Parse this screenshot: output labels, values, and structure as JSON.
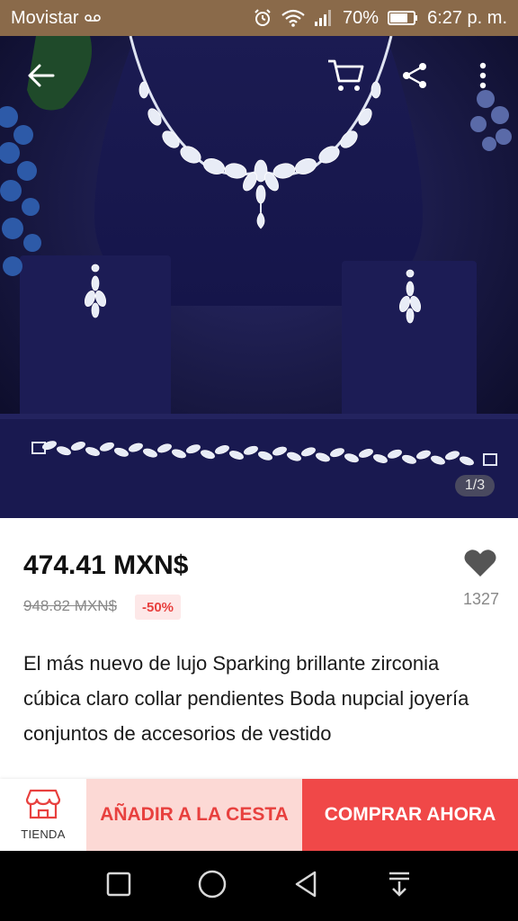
{
  "status_bar": {
    "carrier": "Movistar",
    "battery": "70%",
    "time": "6:27 p. m."
  },
  "icons": {
    "back": "arrow-left-icon",
    "cart": "shopping-cart-icon",
    "share": "share-icon",
    "more": "more-vertical-icon",
    "favorite": "heart-icon",
    "store": "store-icon"
  },
  "gallery": {
    "indicator": "1/3"
  },
  "product": {
    "price": "474.41 MXN$",
    "original_price": "948.82 MXN$",
    "discount": "-50%",
    "favorites_count": "1327",
    "title": "El más nuevo de lujo Sparking brillante zirconia cúbica claro collar pendientes Boda nupcial joyería conjuntos de accesorios de vestido"
  },
  "actions": {
    "store_label": "TIENDA",
    "add_to_cart": "AÑADIR A LA CESTA",
    "buy_now": "COMPRAR AHORA"
  },
  "colors": {
    "accent": "#f04848",
    "accent_light": "#fcd9d5",
    "status_bar": "#8a6a4a"
  }
}
